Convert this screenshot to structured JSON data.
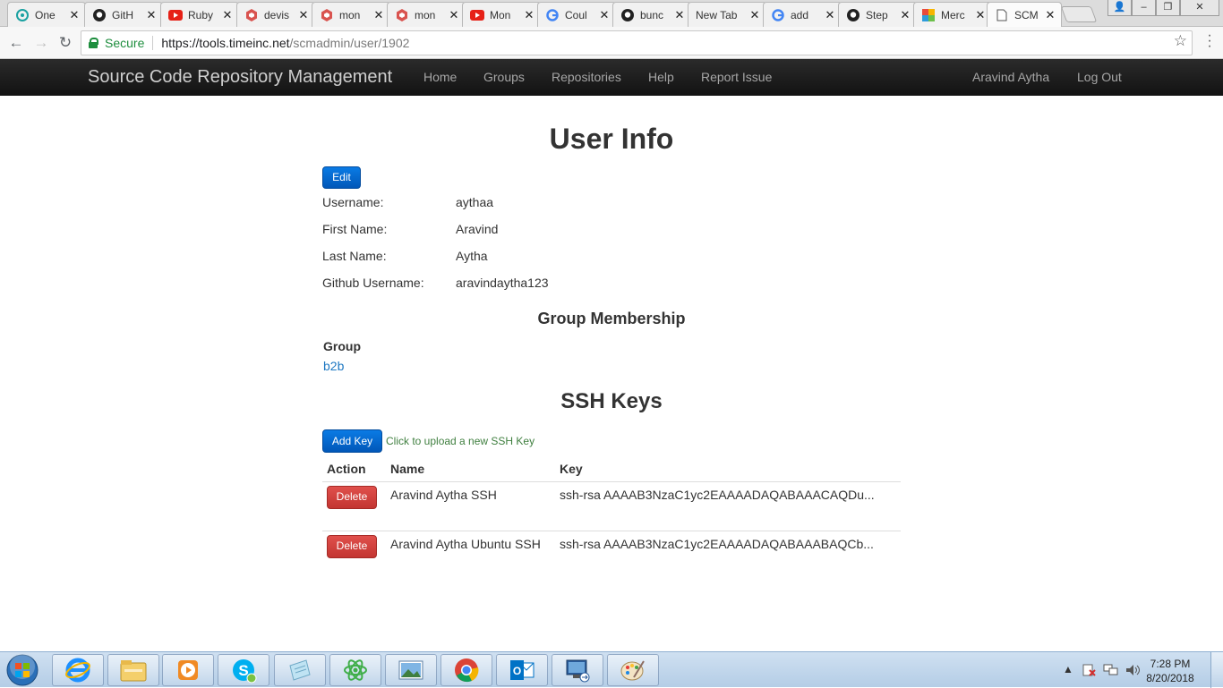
{
  "browser": {
    "tabs": [
      {
        "label": "One",
        "icon": "atom-icon"
      },
      {
        "label": "GitH",
        "icon": "github-icon"
      },
      {
        "label": "Ruby",
        "icon": "youtube-icon"
      },
      {
        "label": "devis",
        "icon": "hexagon-icon"
      },
      {
        "label": "mon",
        "icon": "hexagon-icon"
      },
      {
        "label": "mon",
        "icon": "hexagon-icon"
      },
      {
        "label": "Mon",
        "icon": "youtube-icon"
      },
      {
        "label": "Coul",
        "icon": "google-icon"
      },
      {
        "label": "bunc",
        "icon": "github-icon"
      },
      {
        "label": "New Tab",
        "icon": ""
      },
      {
        "label": "add",
        "icon": "google-icon"
      },
      {
        "label": "Step",
        "icon": "github-icon"
      },
      {
        "label": "Merc",
        "icon": "colorful-icon"
      },
      {
        "label": "SCM",
        "icon": "page-icon"
      }
    ],
    "secure_label": "Secure",
    "url_scheme_host": "https://tools.timeinc.net",
    "url_path": "/scmadmin/user/1902"
  },
  "navbar": {
    "brand": "Source Code Repository Management",
    "links": [
      "Home",
      "Groups",
      "Repositories",
      "Help",
      "Report Issue"
    ],
    "user_name": "Aravind Aytha",
    "logout": "Log Out"
  },
  "page": {
    "title": "User Info",
    "edit_label": "Edit",
    "fields": [
      {
        "label": "Username:",
        "value": "aythaa"
      },
      {
        "label": "First Name:",
        "value": "Aravind"
      },
      {
        "label": "Last Name:",
        "value": "Aytha"
      },
      {
        "label": "Github Username:",
        "value": "aravindaytha123"
      }
    ],
    "group_section_title": "Group Membership",
    "group_header": "Group",
    "groups": [
      "b2b"
    ],
    "ssh_section_title": "SSH Keys",
    "add_key_label": "Add Key",
    "add_key_hint": "Click to upload a new SSH Key",
    "ssh_table": {
      "headers": [
        "Action",
        "Name",
        "Key"
      ],
      "rows": [
        {
          "action": "Delete",
          "name": "Aravind Aytha SSH",
          "key": "ssh-rsa AAAAB3NzaC1yc2EAAAADAQABAAACAQDu..."
        },
        {
          "action": "Delete",
          "name": "Aravind Aytha Ubuntu SSH",
          "key": "ssh-rsa AAAAB3NzaC1yc2EAAAADAQABAAABAQCb..."
        }
      ]
    }
  },
  "taskbar": {
    "clock_time": "7:28 PM",
    "clock_date": "8/20/2018",
    "apps": [
      "internet-explorer-icon",
      "file-explorer-icon",
      "media-player-icon",
      "skype-icon",
      "notepad-icon",
      "atom-icon",
      "photo-viewer-icon",
      "chrome-icon",
      "outlook-icon",
      "remote-desktop-icon",
      "paint-icon"
    ]
  }
}
